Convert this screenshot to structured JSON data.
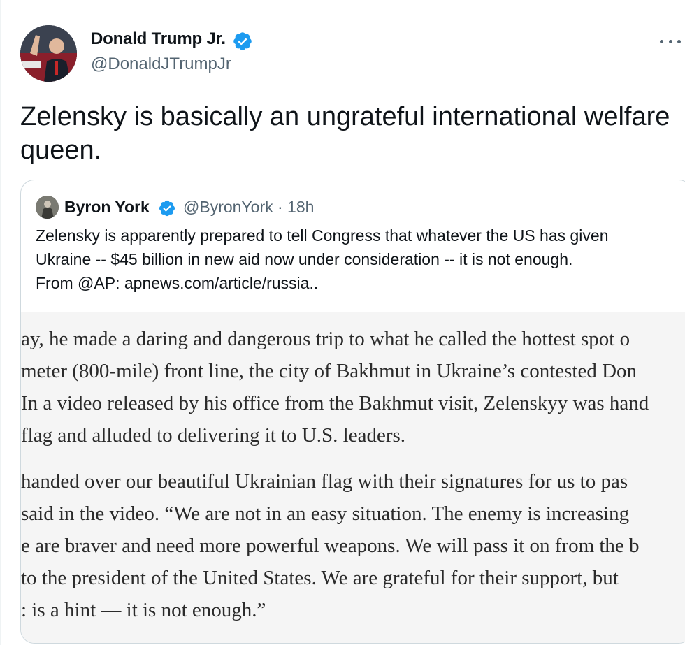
{
  "tweet": {
    "author": {
      "name": "Donald Trump Jr.",
      "handle": "@DonaldJTrumpJr",
      "avatar_icon": "profile-photo",
      "verified_icon": "verified-badge-icon",
      "verified_color": "#1d9bf0"
    },
    "more_icon": "more-options-icon",
    "text": "Zelensky is basically an ungrateful international welfare queen."
  },
  "quoted_tweet": {
    "author_name": "Byron York",
    "handle_time": "@ByronYork · 18h",
    "verified_icon": "verified-badge-icon",
    "lines": [
      "Zelensky is apparently prepared to tell Congress that whatever the US has given",
      "Ukraine -- $45 billion in new aid now under consideration -- it is not enough.",
      "From @AP: apnews.com/article/russia.."
    ],
    "article_excerpt": {
      "paragraph_1": [
        "ay, he made a daring and dangerous trip to what he called the hottest spot o",
        "meter (800-mile) front line, the city of Bakhmut in Ukraine’s contested Don",
        "In a video released by his office from the Bakhmut visit, Zelenskyy was hand",
        " flag and alluded to delivering it to U.S. leaders."
      ],
      "paragraph_2": [
        " handed over our beautiful Ukrainian flag with their signatures for us to pas",
        " said in the video. “We are not in an easy situation. The enemy is increasing",
        "e are braver and need more powerful weapons. We will pass it on from the b",
        " to the president of the United States. We are grateful for their support, but",
        ": is a hint — it is not enough.”"
      ]
    }
  }
}
